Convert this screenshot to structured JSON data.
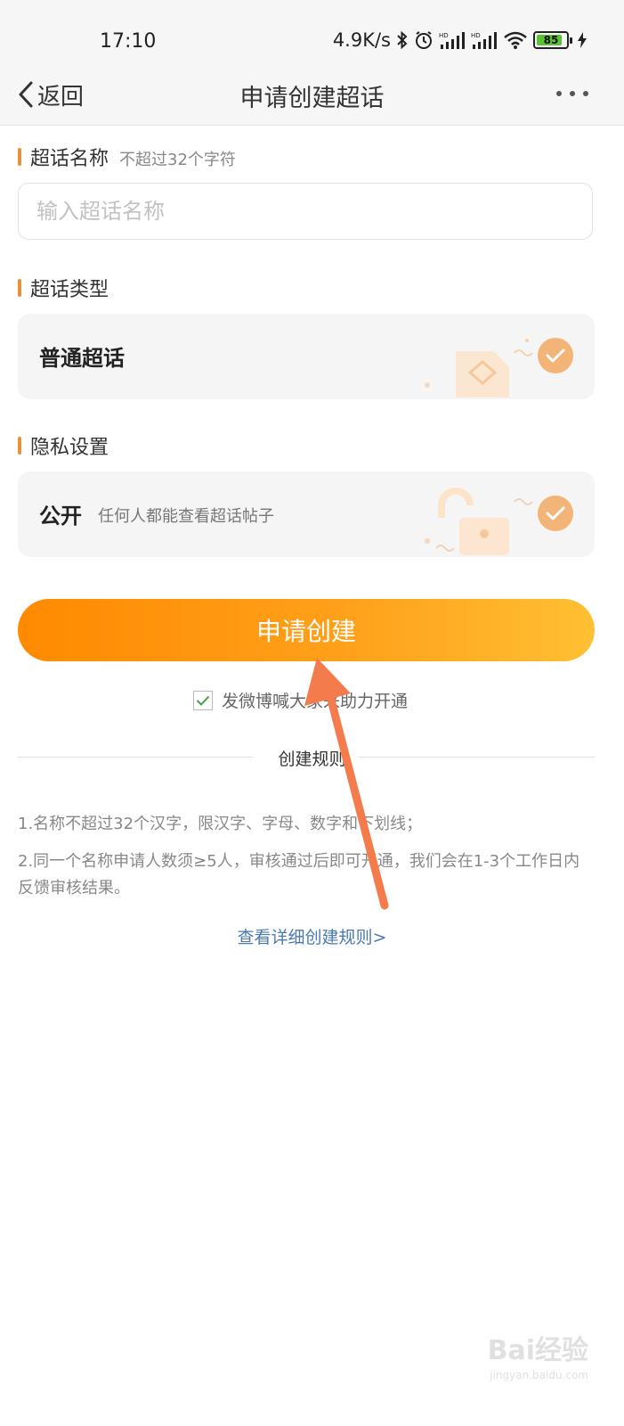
{
  "status_bar": {
    "time": "17:10",
    "net_speed": "4.9K/s",
    "battery_level": "85",
    "icons": [
      "bluetooth-icon",
      "alarm-icon",
      "hd-signal-icon",
      "hd-signal-icon",
      "wifi-icon",
      "battery-icon",
      "charging-icon"
    ]
  },
  "nav": {
    "back_label": "返回",
    "title": "申请创建超话"
  },
  "name_section": {
    "label": "超话名称",
    "hint": "不超过32个字符",
    "placeholder": "输入超话名称"
  },
  "type_section": {
    "label": "超话类型",
    "option_title": "普通超话",
    "selected": true
  },
  "privacy_section": {
    "label": "隐私设置",
    "option_title": "公开",
    "option_desc": "任何人都能查看超话帖子",
    "selected": true
  },
  "submit_label": "申请创建",
  "agree": {
    "checked": true,
    "text": "发微博喊大家来助力开通"
  },
  "rules": {
    "divider_label": "创建规则",
    "items": [
      "1.名称不超过32个汉字，限汉字、字母、数字和下划线；",
      "2.同一个名称申请人数须≥5人，审核通过后即可开通，我们会在1-3个工作日内反馈审核结果。"
    ],
    "link_text": "查看详细创建规则>"
  },
  "watermark": {
    "brand": "Bai经验",
    "url": "jingyan.baidu.com"
  },
  "colors": {
    "accent": "#e8913a",
    "button_start": "#ff8a00",
    "button_end": "#ffc033",
    "check": "#f3b477",
    "link": "#4a7ab0",
    "arrow": "#f37b4c"
  }
}
